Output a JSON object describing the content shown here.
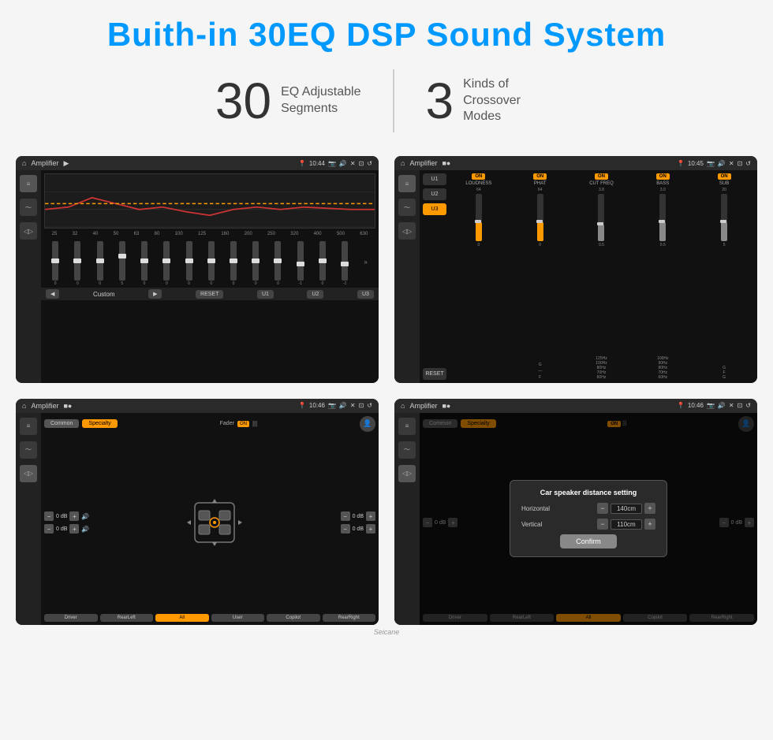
{
  "page": {
    "title": "Buith-in 30EQ DSP Sound System",
    "stat1_number": "30",
    "stat1_label": "EQ Adjustable\nSegments",
    "stat2_number": "3",
    "stat2_label": "Kinds of\nCrossover Modes"
  },
  "screens": {
    "screen1": {
      "status": "Amplifier",
      "time": "10:44",
      "eq_frequencies": [
        "25",
        "32",
        "40",
        "50",
        "63",
        "80",
        "100",
        "125",
        "160",
        "200",
        "250",
        "320",
        "400",
        "500",
        "630"
      ],
      "bottom_buttons": [
        "RESET",
        "U1",
        "U2",
        "U3"
      ],
      "custom_label": "Custom"
    },
    "screen2": {
      "status": "Amplifier",
      "time": "10:45",
      "presets": [
        "U1",
        "U2",
        "U3"
      ],
      "channels": [
        "LOUDNESS",
        "PHAT",
        "CUT FREQ",
        "BASS",
        "SUB"
      ],
      "reset_label": "RESET"
    },
    "screen3": {
      "status": "Amplifier",
      "time": "10:46",
      "common_label": "Common",
      "specialty_label": "Specialty",
      "fader_label": "Fader",
      "on_label": "ON",
      "locations": [
        "Driver",
        "RearLeft",
        "All",
        "User",
        "Copilot",
        "RearRight"
      ],
      "vol_labels": [
        "0 dB",
        "0 dB",
        "0 dB",
        "0 dB"
      ]
    },
    "screen4": {
      "status": "Amplifier",
      "time": "10:46",
      "common_label": "Common",
      "specialty_label": "Specialty",
      "dialog": {
        "title": "Car speaker distance setting",
        "horizontal_label": "Horizontal",
        "horizontal_value": "140cm",
        "vertical_label": "Vertical",
        "vertical_value": "110cm",
        "confirm_label": "Confirm"
      },
      "vol_labels": [
        "0 dB",
        "0 dB"
      ],
      "locations": [
        "Driver",
        "RearLeft",
        "All",
        "Copilot",
        "RearRight"
      ]
    }
  },
  "watermark": "Seicane"
}
